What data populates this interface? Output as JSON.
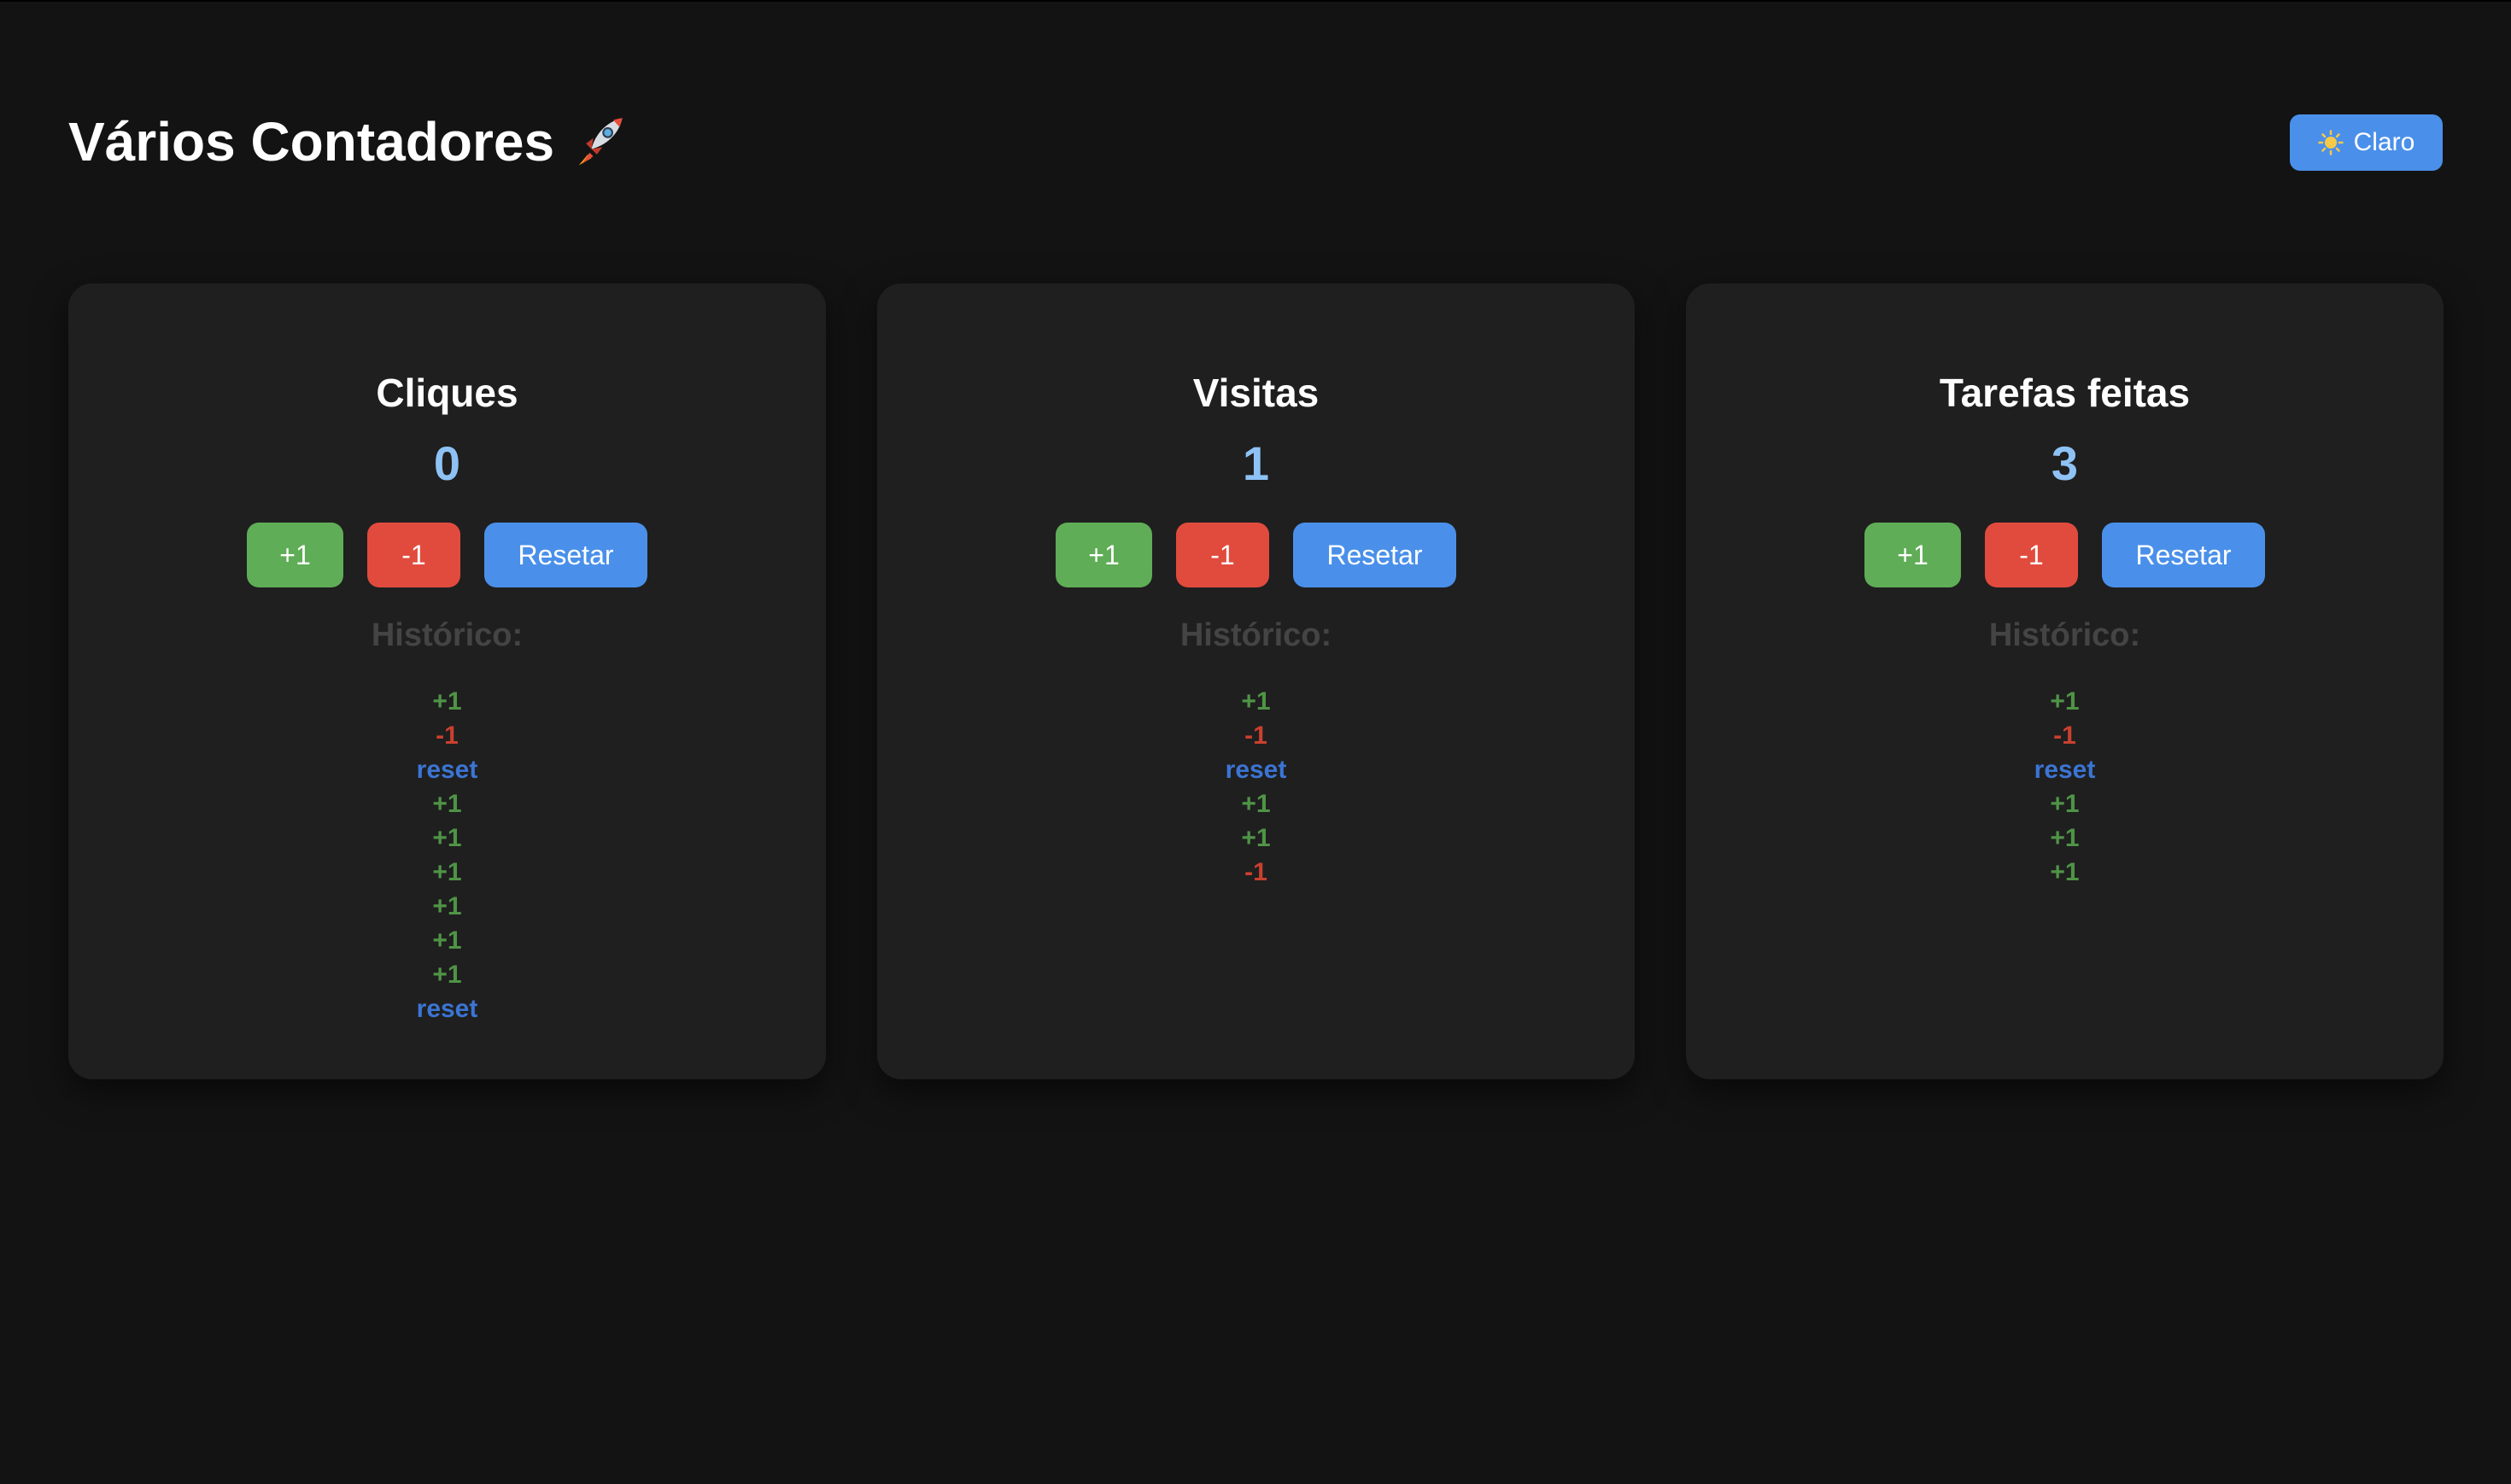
{
  "app": {
    "title": "Vários Contadores",
    "theme_button_label": "Claro",
    "icons": {
      "title_icon": "rocket-icon",
      "theme_icon": "sun-icon"
    }
  },
  "colors": {
    "background": "#131313",
    "card": "#1f1f1f",
    "value": "#8ec2f5",
    "increment": "#5fad56",
    "decrement": "#e14b3e",
    "reset": "#4a90ea"
  },
  "buttons": {
    "increment": "+1",
    "decrement": "-1",
    "reset": "Resetar"
  },
  "history_label": "Histórico:",
  "counters": [
    {
      "name": "Cliques",
      "value": "0",
      "history": [
        "+1",
        "-1",
        "reset",
        "+1",
        "+1",
        "+1",
        "+1",
        "+1",
        "+1",
        "reset"
      ]
    },
    {
      "name": "Visitas",
      "value": "1",
      "history": [
        "+1",
        "-1",
        "reset",
        "+1",
        "+1",
        "-1"
      ]
    },
    {
      "name": "Tarefas feitas",
      "value": "3",
      "history": [
        "+1",
        "-1",
        "reset",
        "+1",
        "+1",
        "+1"
      ]
    }
  ]
}
